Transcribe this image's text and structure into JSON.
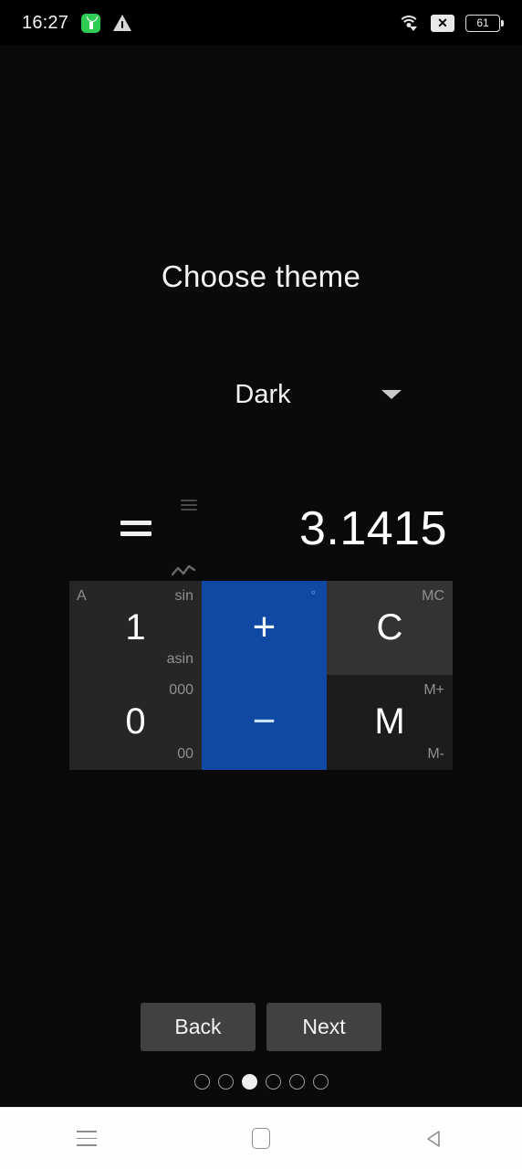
{
  "status_bar": {
    "time": "16:27",
    "battery_level": "61",
    "icons": {
      "app_badge": "app-notification-icon",
      "warning": "warning-triangle-icon",
      "wifi": "wifi-icon",
      "no_sim": "no-sim-icon",
      "battery": "battery-icon"
    }
  },
  "page": {
    "title": "Choose theme"
  },
  "theme_spinner": {
    "selected": "Dark",
    "caret": "chevron-down-icon"
  },
  "calculator_preview": {
    "display": {
      "equals_sign": "=",
      "value": "3.1415",
      "menu_icon": "menu-icon",
      "chart_icon": "line-chart-icon"
    },
    "keys": [
      {
        "main": "1",
        "top_left": "A",
        "top_right": "sin",
        "bottom_right": "asin",
        "style": "num"
      },
      {
        "main": "+",
        "top_right": "°",
        "style": "blue"
      },
      {
        "main": "C",
        "top_right": "MC",
        "style": "light"
      },
      {
        "main": "0",
        "top_right": "000",
        "bottom_right": "00",
        "style": "num"
      },
      {
        "main": "−",
        "style": "blue"
      },
      {
        "main": "M",
        "top_right": "M+",
        "bottom_right": "M-",
        "style": "dark"
      }
    ],
    "colors": {
      "accent_blue": "#1049a4",
      "key_num_bg": "#262626",
      "key_light_bg": "#333333",
      "key_dark_bg": "#1c1c1c"
    }
  },
  "wizard": {
    "back_label": "Back",
    "next_label": "Next",
    "dots_total": 6,
    "dots_active_index": 2
  },
  "navbar": {
    "recents": "recents-icon",
    "home": "home-icon",
    "back": "back-icon"
  }
}
